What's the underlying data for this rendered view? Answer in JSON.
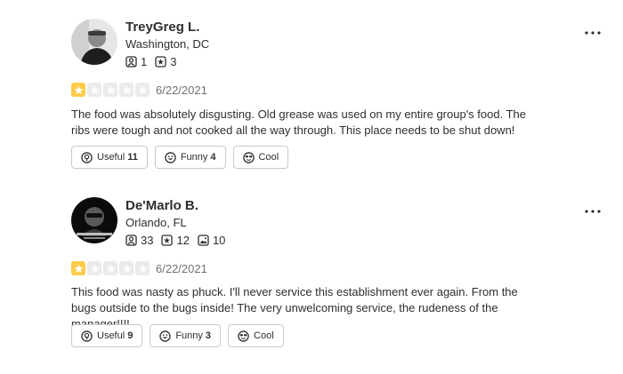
{
  "colors": {
    "star_on": "#ffcc4b",
    "star_off": "#ebebeb",
    "text": "#2d2e2f",
    "muted": "#6e7072",
    "border": "#c8c9ca"
  },
  "reviews": [
    {
      "name": "TreyGreg L.",
      "location": "Washington, DC",
      "friends": "1",
      "reviews": "3",
      "rating": 1,
      "date": "6/22/2021",
      "text": "The food was absolutely disgusting. Old grease was used on my entire group's food. The ribs were tough and not cooked all the way through. This place needs to be shut down!",
      "useful_label": "Useful",
      "useful_count": "11",
      "funny_label": "Funny",
      "funny_count": "4",
      "cool_label": "Cool"
    },
    {
      "name": "De'Marlo B.",
      "location": "Orlando, FL",
      "friends": "33",
      "reviews": "12",
      "photos": "10",
      "rating": 1,
      "date": "6/22/2021",
      "text": "This food was nasty as phuck. I'll never service this establishment ever again. From the bugs outside to the bugs inside! The very unwelcoming service, the rudeness of the manager!!!!",
      "useful_label": "Useful",
      "useful_count": "9",
      "funny_label": "Funny",
      "funny_count": "3",
      "cool_label": "Cool"
    }
  ]
}
